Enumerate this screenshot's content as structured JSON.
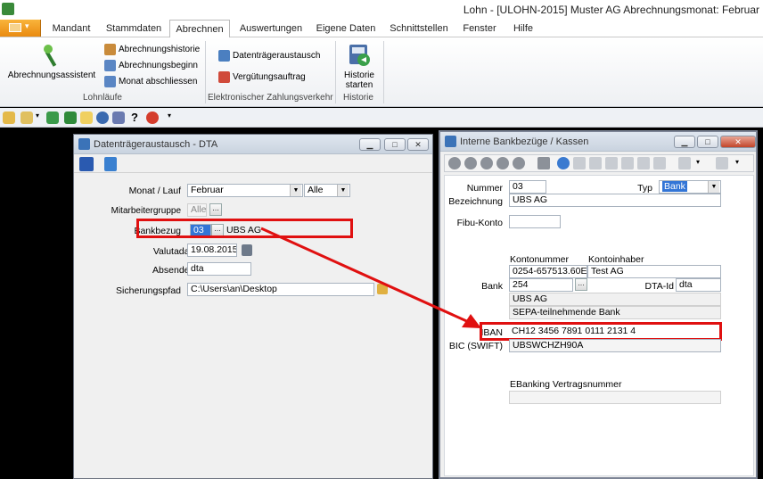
{
  "app": {
    "title": "Lohn - [ULOHN-2015] Muster AG   Abrechnungsmonat: Februar"
  },
  "ribbon_tabs": [
    "Mandant",
    "Stammdaten",
    "Abrechnen",
    "Auswertungen",
    "Eigene Daten",
    "Schnittstellen",
    "Fenster",
    "Hilfe"
  ],
  "ribbon": {
    "abrechnungsassistent": "Abrechnungsassistent",
    "abrechnungshistorie": "Abrechnungshistorie",
    "abrechnungsbeginn": "Abrechnungsbeginn",
    "monat_abschliessen": "Monat abschliessen",
    "group_lohnlaeufe": "Lohnläufe",
    "datentraegeraustausch": "Datenträgeraustausch",
    "verguetungsauftrag": "Vergütungsauftrag",
    "group_zahlungsverkehr": "Elektronischer Zahlungsverkehr",
    "historie_starten_1": "Historie",
    "historie_starten_2": "starten",
    "group_historie": "Historie"
  },
  "dta": {
    "title": "Datenträgeraustausch - DTA",
    "monat_lauf_label": "Monat / Lauf",
    "monat_value": "Februar",
    "lauf_value": "Alle",
    "mitarbeitergruppe_label": "Mitarbeitergruppe",
    "mitarbeitergruppe_value": "Alle",
    "bankbezug_label": "Bankbezug",
    "bankbezug_code": "03",
    "bankbezug_name": "UBS AG",
    "valutadatum_label": "Valutadatum",
    "valutadatum_value": "19.08.2015",
    "absender_label": "Absender-ID",
    "absender_value": "dta",
    "sicherungspfad_label": "Sicherungspfad",
    "sicherungspfad_value": "C:\\Users\\an\\Desktop"
  },
  "bank": {
    "title": "Interne Bankbezüge / Kassen",
    "nummer_label": "Nummer",
    "nummer_value": "03",
    "typ_label": "Typ",
    "typ_value": "Bank",
    "bezeichnung_label": "Bezeichnung",
    "bezeichnung_value": "UBS AG",
    "fibu_label": "Fibu-Konto",
    "fibu_value": "",
    "kontonummer_label": "Kontonummer",
    "kontoinhaber_label": "Kontoinhaber",
    "kontonummer_value": "0254-657513.60E",
    "kontoinhaber_value": "Test AG",
    "bank_label": "Bank",
    "bank_value": "254",
    "dta_id_label": "DTA-Id",
    "dta_id_value": "dta",
    "bank_name": "UBS AG",
    "bank_info": "SEPA-teilnehmende Bank",
    "iban_label": "IBAN",
    "iban_value": "CH12 3456 7891 0111 2131 4",
    "bic_label": "BIC (SWIFT)",
    "bic_value": "UBSWCHZH90A",
    "ebanking_label": "EBanking Vertragsnummer",
    "ebanking_value": ""
  },
  "colors": {
    "highlight": "#e01010",
    "file_tab": "#f0a020",
    "selection": "#3375d6"
  }
}
